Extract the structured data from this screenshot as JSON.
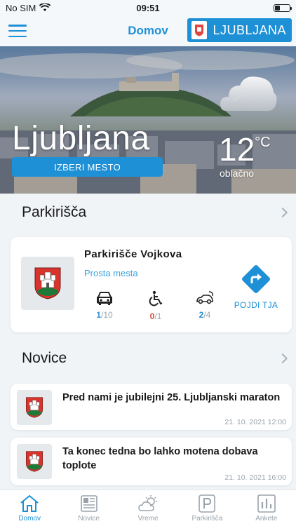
{
  "status_bar": {
    "carrier": "No SIM",
    "time": "09:51"
  },
  "nav": {
    "title": "Domov",
    "city_button": "LJUBLJANA"
  },
  "hero": {
    "city": "Ljubljana",
    "choose_city": "IZBERI MESTO",
    "temperature": "12",
    "unit": "°C",
    "weather": "oblačno",
    "weather_icon": "cloud-icon"
  },
  "parking": {
    "section_title": "Parkirišča",
    "name": "Parkirišče Vojkova",
    "status": "Prosta mesta",
    "stats": [
      {
        "icon": "car-icon",
        "free": "1",
        "total": "/10",
        "color": "#2a8fd0"
      },
      {
        "icon": "wheelchair-icon",
        "free": "0",
        "total": "/1",
        "color": "#e0463f"
      },
      {
        "icon": "electric-car-icon",
        "free": "2",
        "total": "/4",
        "color": "#2a8fd0"
      }
    ],
    "go_label": "POJDI TJA"
  },
  "news": {
    "section_title": "Novice",
    "items": [
      {
        "title": "Pred nami je jubilejni 25. Ljubljanski maraton",
        "date": "21. 10. 2021 12:00"
      },
      {
        "title": "Ta konec tedna bo lahko motena dobava toplote",
        "date": "21. 10. 2021 16:00"
      }
    ]
  },
  "tabs": [
    {
      "label": "Domov",
      "icon": "home-icon",
      "active": true
    },
    {
      "label": "Novice",
      "icon": "newspaper-icon",
      "active": false
    },
    {
      "label": "Vreme",
      "icon": "weather-icon",
      "active": false
    },
    {
      "label": "Parkirišča",
      "icon": "parking-icon",
      "active": false
    },
    {
      "label": "Ankete",
      "icon": "poll-icon",
      "active": false
    }
  ],
  "colors": {
    "accent": "#1e90d6",
    "red": "#e0463f",
    "muted": "#9aa3ab"
  }
}
